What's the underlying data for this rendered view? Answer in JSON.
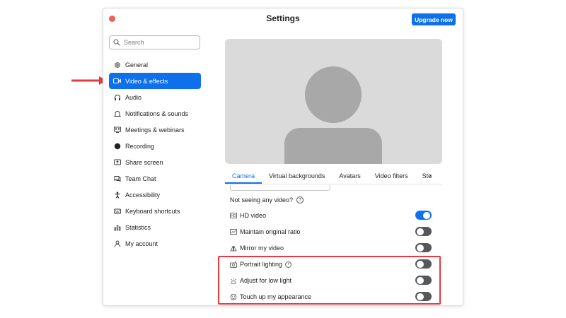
{
  "window": {
    "title": "Settings",
    "upgrade_label": "Upgrade now"
  },
  "search": {
    "placeholder": "Search"
  },
  "sidebar": {
    "items": [
      {
        "label": "General",
        "icon": "gear-icon"
      },
      {
        "label": "Video & effects",
        "icon": "video-camera-icon",
        "active": true
      },
      {
        "label": "Audio",
        "icon": "headphones-icon"
      },
      {
        "label": "Notifications & sounds",
        "icon": "bell-icon"
      },
      {
        "label": "Meetings & webinars",
        "icon": "meetings-icon"
      },
      {
        "label": "Recording",
        "icon": "record-icon"
      },
      {
        "label": "Share screen",
        "icon": "share-screen-icon"
      },
      {
        "label": "Team Chat",
        "icon": "chat-icon"
      },
      {
        "label": "Accessibility",
        "icon": "accessibility-icon"
      },
      {
        "label": "Keyboard shortcuts",
        "icon": "keyboard-icon"
      },
      {
        "label": "Statistics",
        "icon": "statistics-icon"
      },
      {
        "label": "My account",
        "icon": "person-icon"
      }
    ]
  },
  "tabs": {
    "items": [
      "Camera",
      "Virtual backgrounds",
      "Avatars",
      "Video filters",
      "Stu"
    ],
    "active": "Camera"
  },
  "camera": {
    "not_seeing_label": "Not seeing any video?",
    "options": [
      {
        "label": "HD video",
        "icon": "hd-icon",
        "enabled": true
      },
      {
        "label": "Maintain original ratio",
        "icon": "ratio-icon",
        "enabled": false
      },
      {
        "label": "Mirror my video",
        "icon": "mirror-icon",
        "enabled": false
      },
      {
        "label": "Portrait lighting",
        "icon": "portrait-lighting-icon",
        "enabled": false,
        "info": true
      },
      {
        "label": "Adjust for low light",
        "icon": "low-light-icon",
        "enabled": false
      },
      {
        "label": "Touch up my appearance",
        "icon": "touch-up-icon",
        "enabled": false
      }
    ]
  },
  "colors": {
    "accent": "#0e71eb",
    "annotation": "#e53b3f",
    "toggle_off": "#55575b",
    "preview_bg": "#dadada",
    "avatar": "#a8a8a8"
  }
}
